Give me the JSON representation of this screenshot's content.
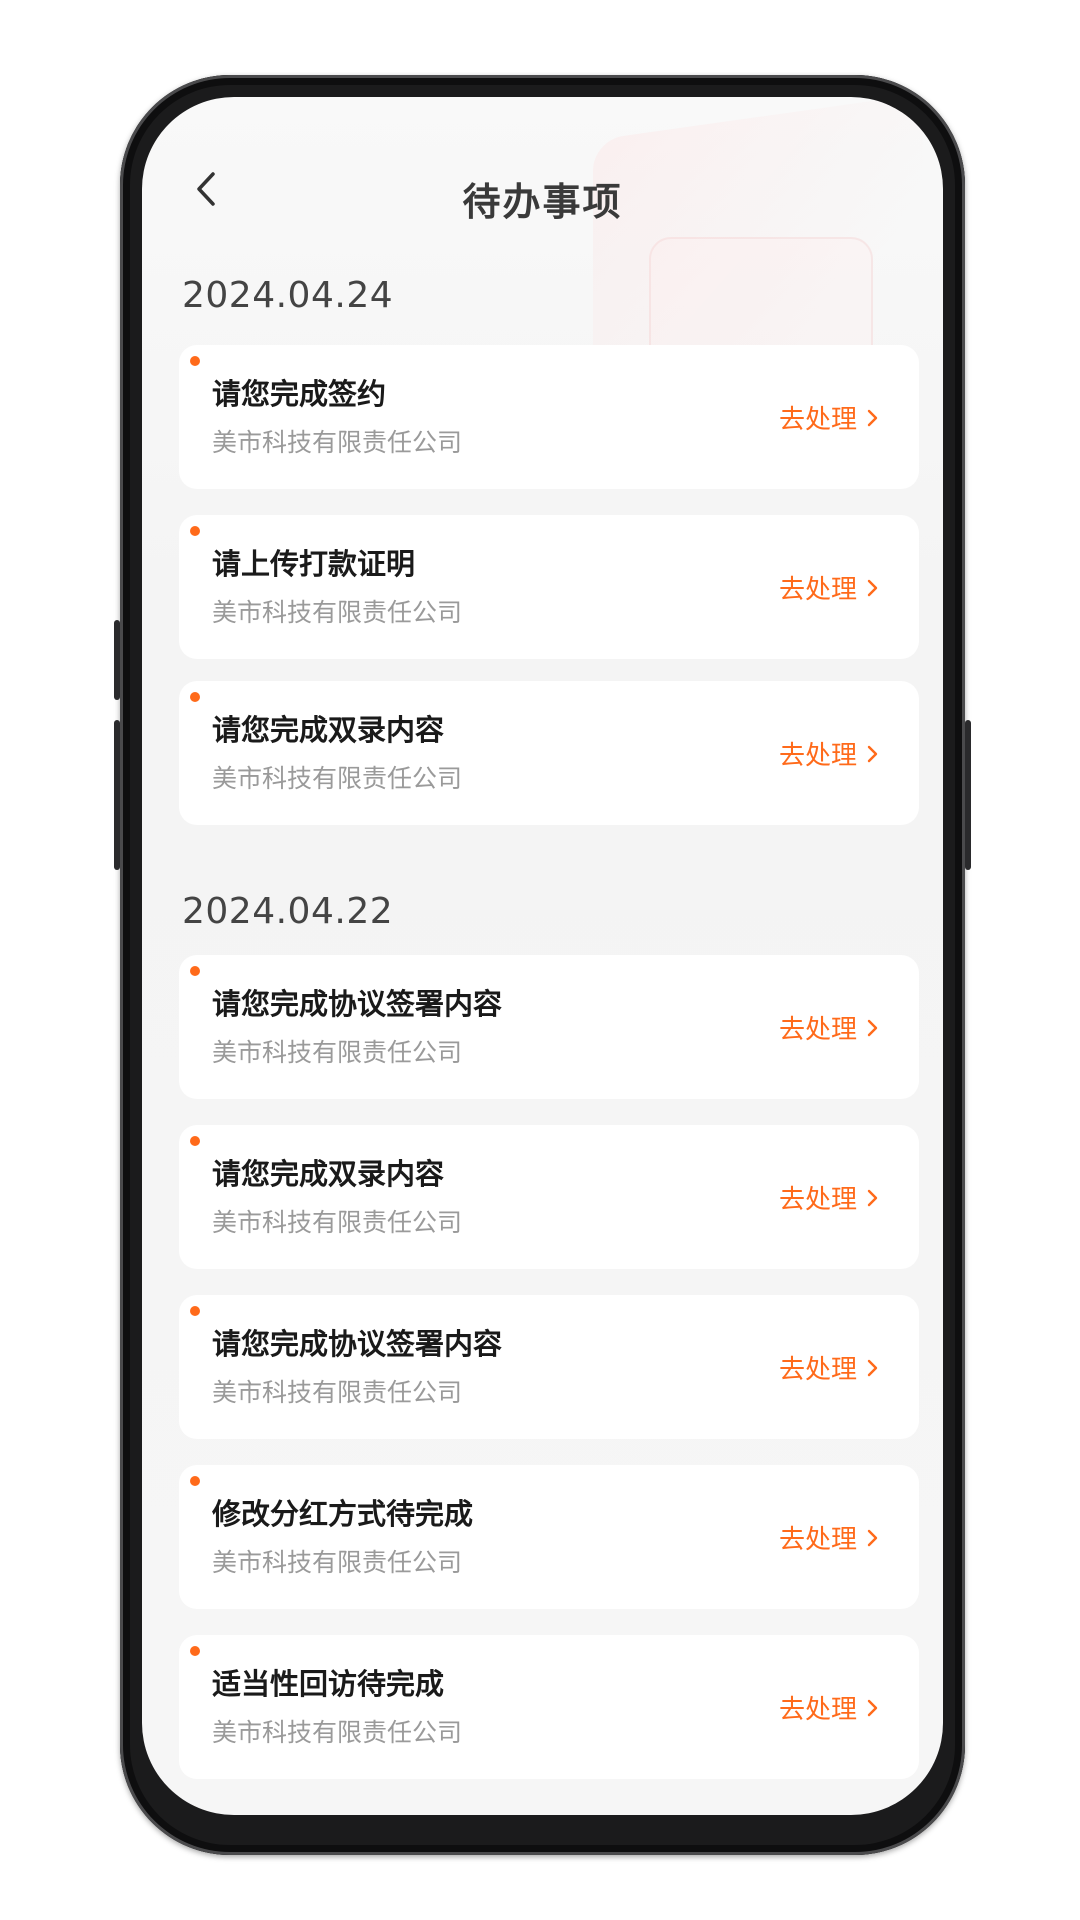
{
  "header": {
    "title": "待办事项"
  },
  "groups": [
    {
      "date": "2024.04.24",
      "items": [
        {
          "title": "请您完成签约",
          "company": "美市科技有限责任公司",
          "action": "去处理"
        },
        {
          "title": "请上传打款证明",
          "company": "美市科技有限责任公司",
          "action": "去处理"
        },
        {
          "title": "请您完成双录内容",
          "company": "美市科技有限责任公司",
          "action": "去处理"
        }
      ]
    },
    {
      "date": "2024.04.22",
      "items": [
        {
          "title": "请您完成协议签署内容",
          "company": "美市科技有限责任公司",
          "action": "去处理"
        },
        {
          "title": "请您完成双录内容",
          "company": "美市科技有限责任公司",
          "action": "去处理"
        },
        {
          "title": "请您完成协议签署内容",
          "company": "美市科技有限责任公司",
          "action": "去处理"
        },
        {
          "title": "修改分红方式待完成",
          "company": "美市科技有限责任公司",
          "action": "去处理"
        },
        {
          "title": "适当性回访待完成",
          "company": "美市科技有限责任公司",
          "action": "去处理"
        }
      ]
    }
  ],
  "colors": {
    "accent": "#ff6a1a",
    "title": "#1a1a1a",
    "subtitle": "#9a9a9a"
  },
  "icons": {
    "back": "chevron-left-icon",
    "action": "chevron-right-icon",
    "unread": "unread-dot-icon"
  }
}
